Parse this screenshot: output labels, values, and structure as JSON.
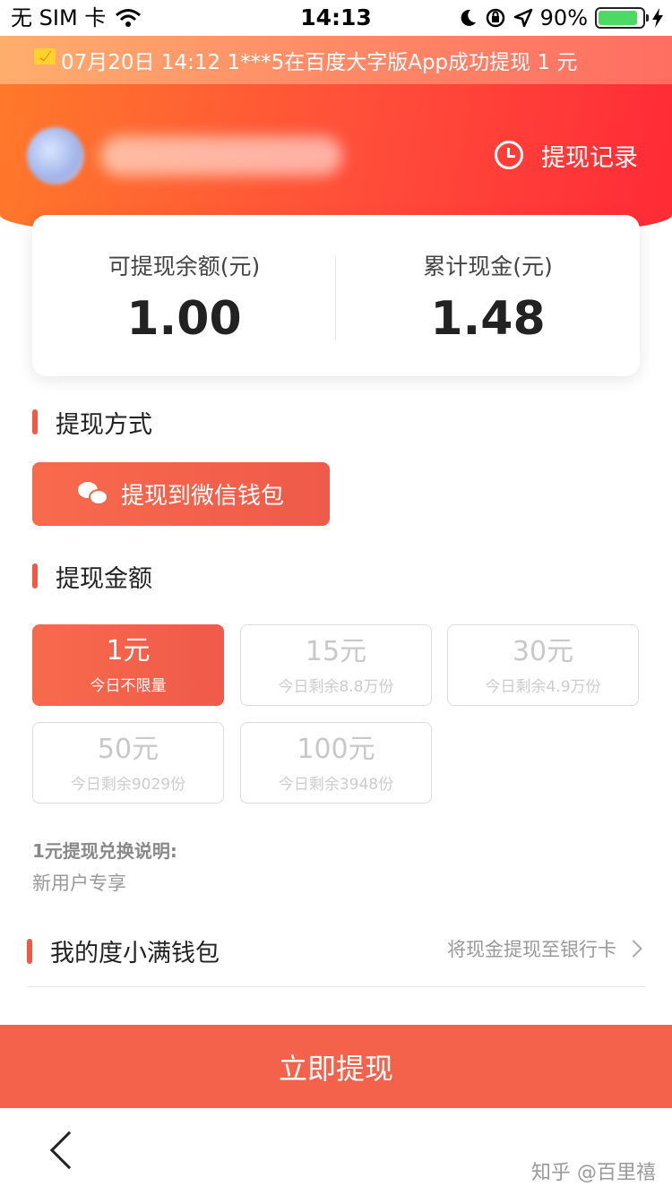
{
  "status_bar": {
    "carrier": "无 SIM 卡",
    "time": "14:13",
    "battery": "90%",
    "battery_level": 0.9
  },
  "ticker": {
    "message": "07月20日 14:12 1***5在百度大字版App成功提现 1 元"
  },
  "header": {
    "history_label": "提现记录"
  },
  "balance": {
    "withdrawable_label": "可提现余额(元)",
    "withdrawable_value": "1.00",
    "total_label": "累计现金(元)",
    "total_value": "1.48"
  },
  "method": {
    "section_title": "提现方式",
    "wechat_label": "提现到微信钱包"
  },
  "amount": {
    "section_title": "提现金额",
    "options": [
      {
        "value": "1元",
        "sub": "今日不限量",
        "selected": true
      },
      {
        "value": "15元",
        "sub": "今日剩余8.8万份",
        "selected": false
      },
      {
        "value": "30元",
        "sub": "今日剩余4.9万份",
        "selected": false
      },
      {
        "value": "50元",
        "sub": "今日剩余9029份",
        "selected": false
      },
      {
        "value": "100元",
        "sub": "今日剩余3948份",
        "selected": false
      }
    ],
    "explain_title": "1元提现兑换说明:",
    "explain_text": "新用户专享"
  },
  "wallet": {
    "title": "我的度小满钱包",
    "link": "将现金提现至银行卡"
  },
  "submit_label": "立即提现",
  "watermark": "知乎 @百里禧",
  "colors": {
    "accent": "#f4624b",
    "header_start": "#ff7a2a",
    "header_end": "#ff2a36"
  }
}
